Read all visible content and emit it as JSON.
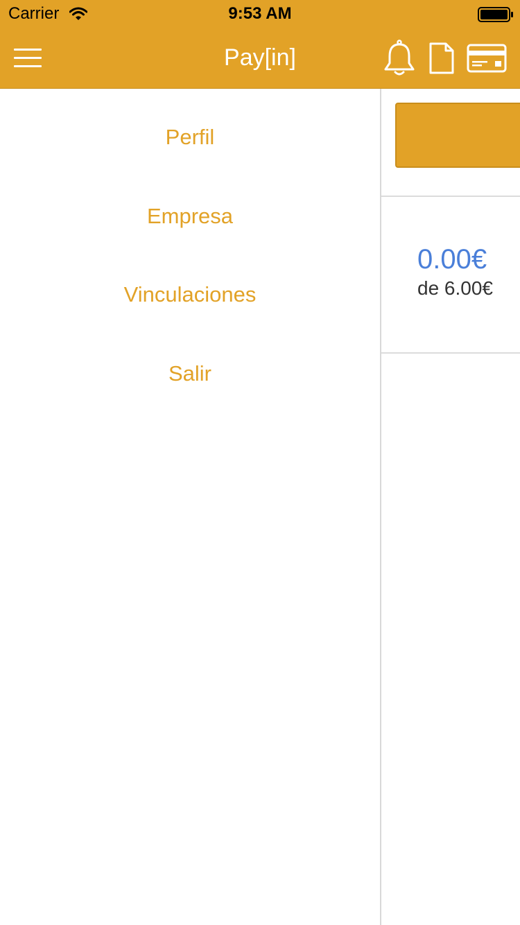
{
  "status_bar": {
    "carrier": "Carrier",
    "time": "9:53 AM"
  },
  "nav": {
    "title": "Pay[in]",
    "icons": [
      "menu-icon",
      "bell-icon",
      "document-icon",
      "credit-card-icon"
    ]
  },
  "drawer": {
    "items": [
      {
        "label": "Perfil"
      },
      {
        "label": "Empresa"
      },
      {
        "label": "Vinculaciones"
      },
      {
        "label": "Salir"
      }
    ]
  },
  "content": {
    "amount": "0.00€",
    "amount_total": "de 6.00€"
  },
  "colors": {
    "accent": "#e2a227",
    "amount_blue": "#4a7fd9",
    "text_dark": "#333333"
  }
}
